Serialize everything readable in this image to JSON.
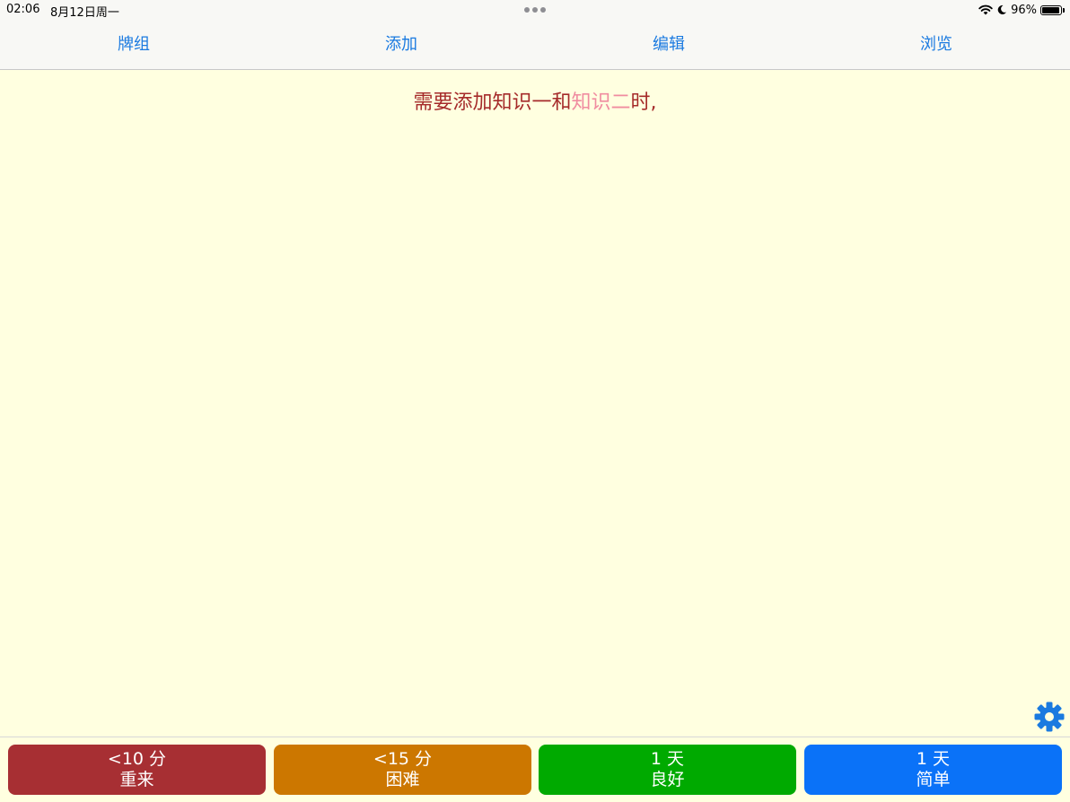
{
  "status_bar": {
    "time": "02:06",
    "date": "8月12日周一",
    "battery_percent_label": "96%",
    "battery_level": 0.96,
    "icons": [
      "wifi-icon",
      "moon-icon",
      "battery-icon"
    ]
  },
  "toolbar": {
    "decks_label": "牌组",
    "add_label": "添加",
    "edit_label": "编辑",
    "browse_label": "浏览",
    "link_color": "#1a7ae0"
  },
  "card": {
    "text_before": "需要添加知识一和",
    "cloze": "知识二",
    "text_after": "时,",
    "text_color": "#a52a2a",
    "cloze_color": "#f08ca0",
    "background": "#ffffe0"
  },
  "settings": {
    "icon": "gear-icon",
    "color": "#1a7ae0"
  },
  "answer_buttons": {
    "again": {
      "interval": "<10 分",
      "label": "重来",
      "color": "#a72f33"
    },
    "hard": {
      "interval": "<15 分",
      "label": "困难",
      "color": "#cc7700"
    },
    "good": {
      "interval": "1 天",
      "label": "良好",
      "color": "#00aa00"
    },
    "easy": {
      "interval": "1 天",
      "label": "简单",
      "color": "#0a72f8"
    }
  }
}
